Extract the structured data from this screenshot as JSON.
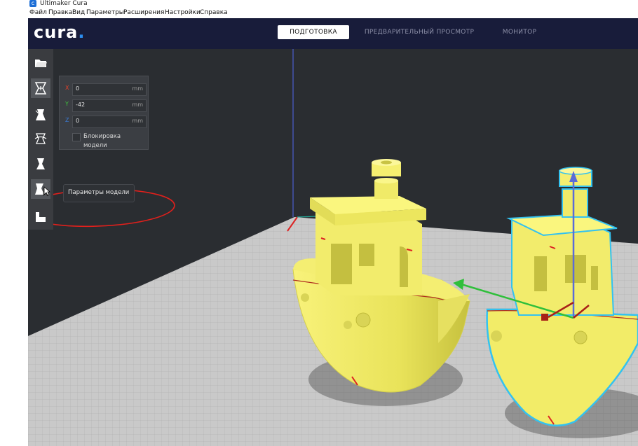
{
  "window": {
    "title": "Ultimaker Cura",
    "icon": "cura-app-icon"
  },
  "menu": [
    "Файл",
    "Правка",
    "Вид",
    "Параметры",
    "Расширения",
    "Настройки",
    "Справка"
  ],
  "header": {
    "logo": "cura",
    "tabs": [
      {
        "label": "ПОДГОТОВКА",
        "active": true
      },
      {
        "label": "ПРЕДВАРИТЕЛЬНЫЙ ПРОСМОТР",
        "active": false
      },
      {
        "label": "МОНИТОР",
        "active": false
      }
    ]
  },
  "toolbar": {
    "items": [
      "open-file-icon",
      "move-tool-icon",
      "scale-tool-icon",
      "rotate-tool-icon",
      "mirror-tool-icon",
      "per-model-settings-icon",
      "support-blocker-icon"
    ]
  },
  "move_panel": {
    "fields": [
      {
        "axis": "X",
        "value": "0",
        "unit": "mm",
        "color": "#e0402a"
      },
      {
        "axis": "Y",
        "value": "-42",
        "unit": "mm",
        "color": "#3ec43e"
      },
      {
        "axis": "Z",
        "value": "0",
        "unit": "mm",
        "color": "#3a7bd5"
      }
    ],
    "lock_label": "Блокировка модели"
  },
  "tooltip": {
    "text": "Параметры модели"
  },
  "colors": {
    "header": "#181c3a",
    "accent": "#2c8ef0",
    "model": "#f5ef6a",
    "selection": "#33c2f0",
    "annotation": "#e0201c"
  }
}
